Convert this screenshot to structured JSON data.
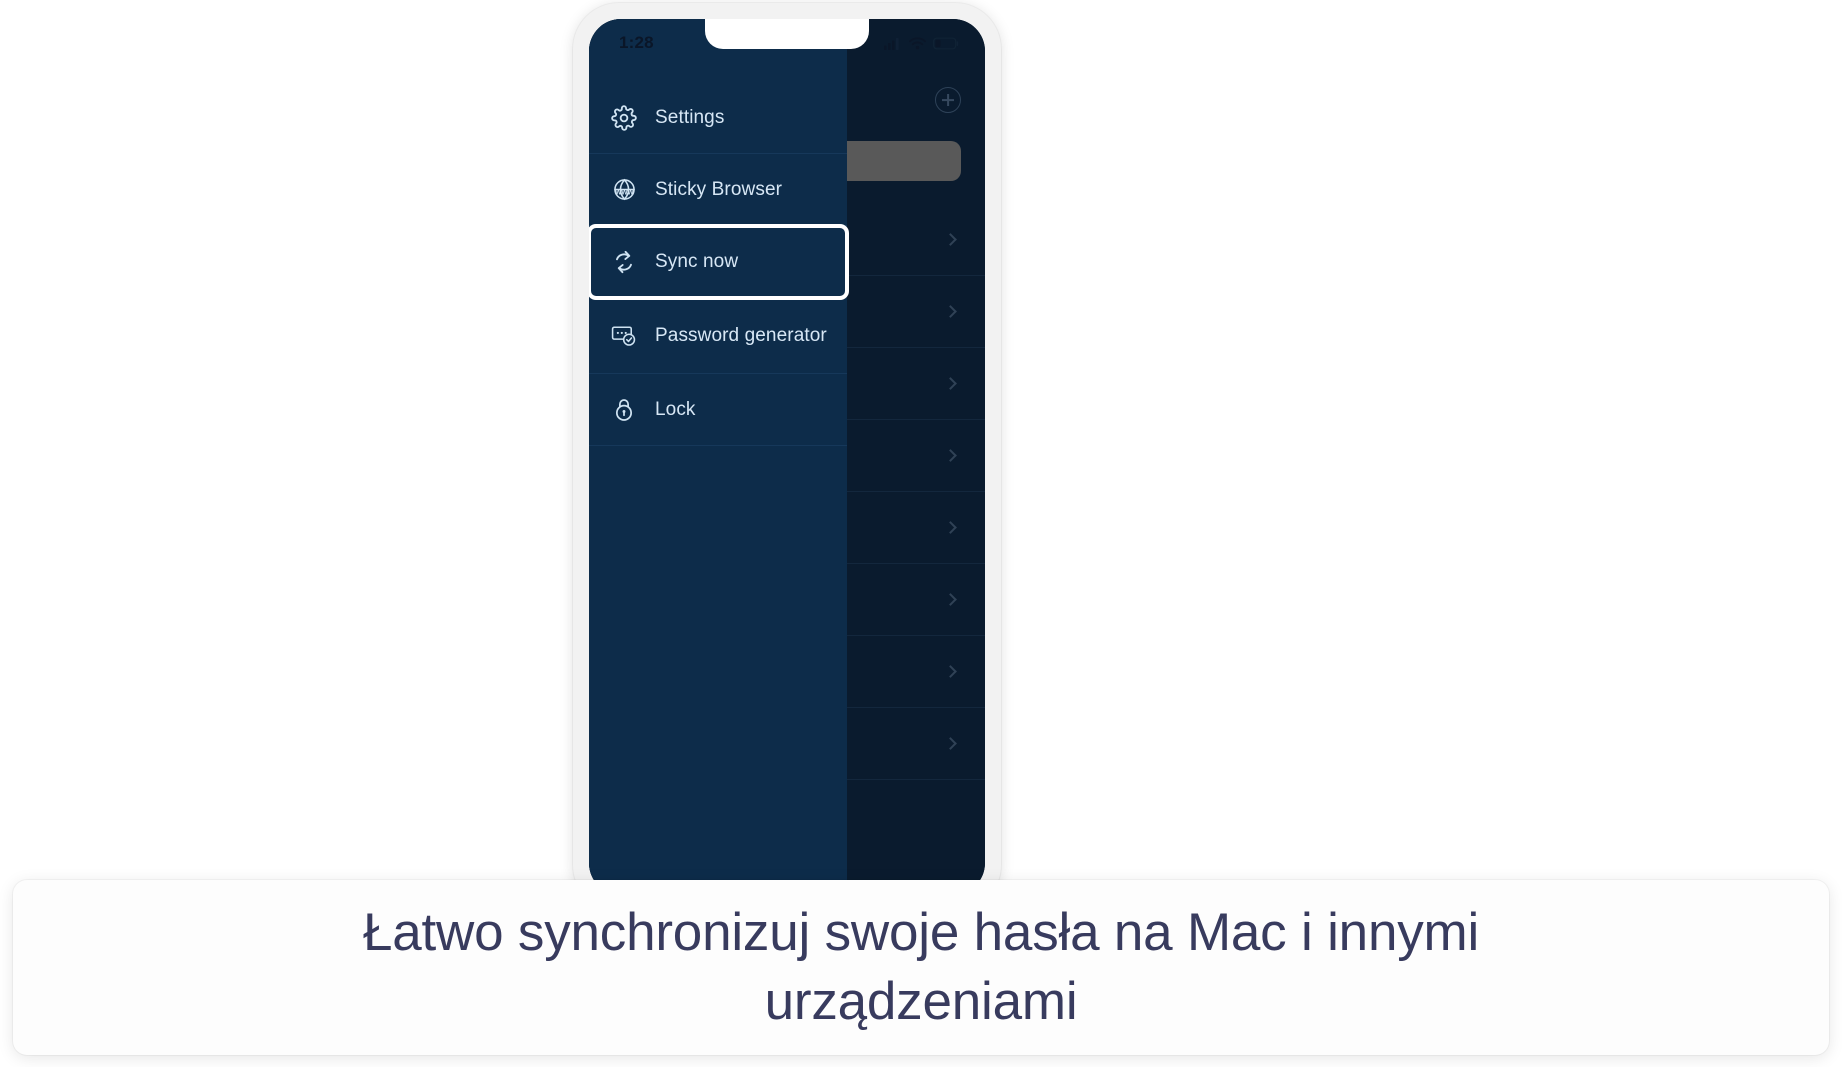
{
  "status_bar": {
    "time": "1:28",
    "icons": [
      "cellular-signal-icon",
      "wifi-icon",
      "battery-icon"
    ]
  },
  "background_app": {
    "add_button_icon": "plus-circle-icon",
    "search_bar_value": "",
    "rows": [
      {
        "chevron": "chevron-right-icon"
      },
      {
        "chevron": "chevron-right-icon"
      },
      {
        "chevron": "chevron-right-icon"
      },
      {
        "chevron": "chevron-right-icon"
      },
      {
        "chevron": "chevron-right-icon"
      },
      {
        "chevron": "chevron-right-icon"
      },
      {
        "chevron": "chevron-right-icon"
      },
      {
        "chevron": "chevron-right-icon"
      }
    ]
  },
  "drawer": {
    "items": [
      {
        "label": "Settings",
        "icon": "gear-icon",
        "highlighted": false
      },
      {
        "label": "Sticky Browser",
        "icon": "www-globe-icon",
        "highlighted": false
      },
      {
        "label": "Sync now",
        "icon": "sync-refresh-icon",
        "highlighted": true
      },
      {
        "label": "Password generator",
        "icon": "password-card-check-icon",
        "highlighted": false
      },
      {
        "label": "Lock",
        "icon": "padlock-icon",
        "highlighted": false
      }
    ]
  },
  "caption": {
    "text": "Łatwo synchronizuj swoje hasła na Mac i innymi urządzeniami"
  },
  "colors": {
    "drawer_bg": "#0d2c4a",
    "app_bg": "#0a1b2e",
    "device_frame": "#f2f2f2",
    "menu_text": "#d7e7f5",
    "highlight_outline": "#ffffff",
    "caption_text": "#383b5e",
    "search_bar": "#595959"
  }
}
